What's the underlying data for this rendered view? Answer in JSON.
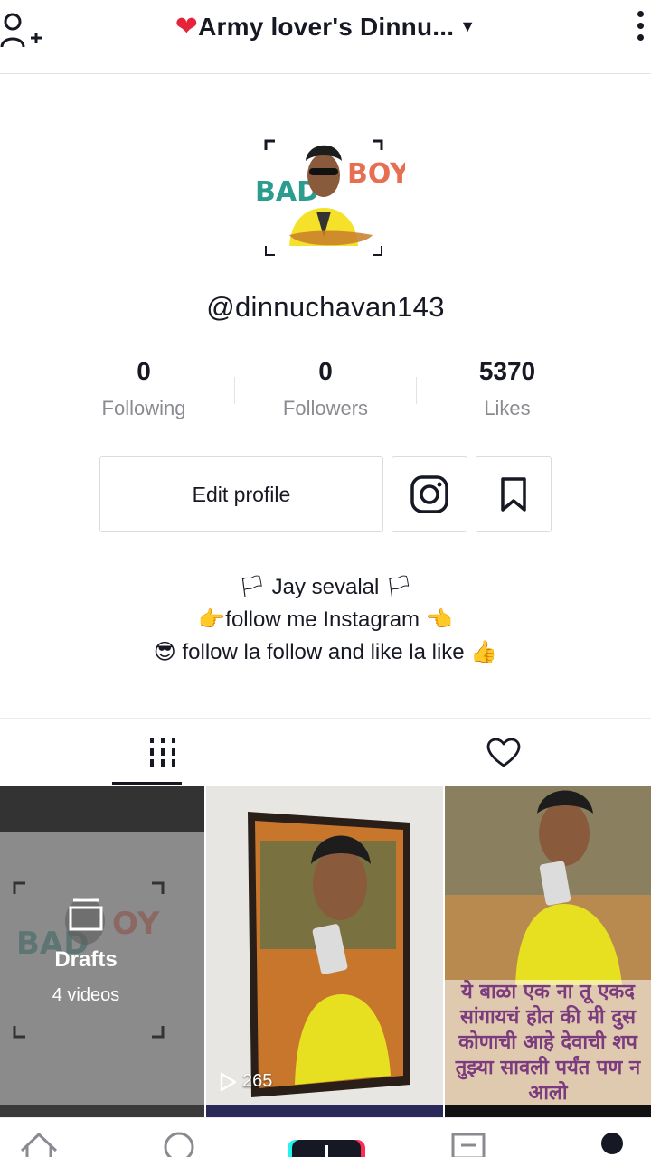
{
  "header": {
    "title": "Army lover's Dinnu...",
    "heart": "❤",
    "caret": "▼"
  },
  "profile": {
    "username": "@dinnuchavan143",
    "avatar_logo_text": "BAD BOY"
  },
  "stats": [
    {
      "value": "0",
      "label": "Following"
    },
    {
      "value": "0",
      "label": "Followers"
    },
    {
      "value": "5370",
      "label": "Likes"
    }
  ],
  "actions": {
    "edit_label": "Edit profile"
  },
  "bio": {
    "line1": "🏳 Jay sevalal 🏳",
    "line2": "👉follow me Instagram 👈",
    "line3": "😎 follow la follow and like la like 👍"
  },
  "tabs": [
    {
      "icon": "videos-grid-icon",
      "active": true
    },
    {
      "icon": "heart-icon",
      "active": false
    }
  ],
  "videos": {
    "drafts_label": "Drafts",
    "drafts_count": "4 videos",
    "play_count": "265",
    "overlay_lines": [
      "ये बाळा एक ना तू एकद",
      "सांगायचं होत की मी दुस",
      "कोणाची आहे देवाची शप",
      "तुझ्या सावली पर्यंत पण न",
      "आलो"
    ]
  },
  "colors": {
    "text": "#161823",
    "secondary": "#8a8b91",
    "heart": "#e5233a",
    "create_cyan": "#25f4ee",
    "create_pink": "#fe2c55"
  }
}
